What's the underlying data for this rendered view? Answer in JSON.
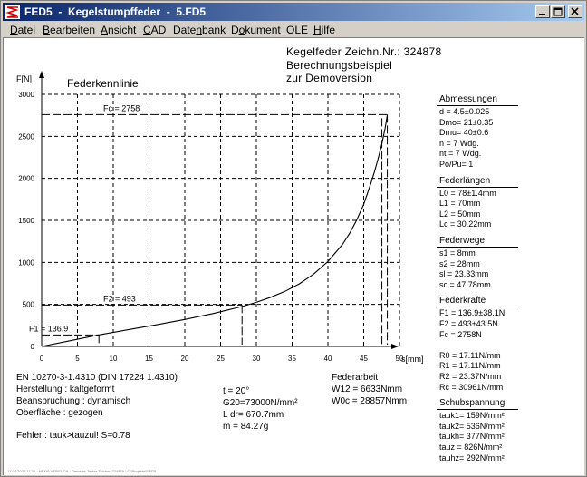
{
  "window": {
    "title": "FED5  -  Kegelstumpffeder  -  5.FD5",
    "icon": "fed5-app-icon",
    "buttons": [
      "minimize",
      "maximize",
      "close"
    ]
  },
  "menu": [
    {
      "label": "Datei",
      "u": 0
    },
    {
      "label": "Bearbeiten",
      "u": 0
    },
    {
      "label": "Ansicht",
      "u": 0
    },
    {
      "label": "CAD",
      "u": 0
    },
    {
      "label": "Datenbank",
      "u": 4
    },
    {
      "label": "Dokument",
      "u": 1
    },
    {
      "label": "OLE",
      "u": -1
    },
    {
      "label": "Hilfe",
      "u": 0
    }
  ],
  "header": {
    "line1": "Kegelfeder  Zeichn.Nr.: 324878",
    "line2": "Berechnungsbeispiel",
    "line3": "zur Demoversion"
  },
  "chart_data": {
    "type": "line",
    "title": "Federkennlinie",
    "ylabel": "F[N]",
    "xlabel": "s[mm]",
    "xlim": [
      0,
      50
    ],
    "ylim": [
      0,
      3000
    ],
    "xticks": [
      0,
      5,
      10,
      15,
      20,
      25,
      30,
      35,
      40,
      45,
      50
    ],
    "yticks": [
      0,
      500,
      1000,
      1500,
      2000,
      2500,
      3000
    ],
    "grid": true,
    "series": [
      {
        "x": [
          0,
          4,
          8,
          12,
          16,
          20,
          24,
          26,
          28,
          30,
          32,
          34,
          36,
          38,
          40,
          42,
          43,
          44,
          45,
          46,
          46.5,
          47,
          47.5,
          48,
          48.3
        ],
        "y": [
          0,
          68,
          136.9,
          197,
          257,
          320,
          392,
          434,
          475,
          525,
          585,
          655,
          745,
          860,
          1010,
          1210,
          1340,
          1500,
          1690,
          1940,
          2080,
          2230,
          2400,
          2600,
          2758
        ]
      }
    ],
    "annotations": [
      {
        "label": "Fc = 2758",
        "x": 48.3,
        "y": 2758
      },
      {
        "label": "F2 = 493",
        "x": 28,
        "y": 493
      },
      {
        "label": "F1 = 136.9",
        "x": 8,
        "y": 136.9
      }
    ]
  },
  "info_left": {
    "norm": "EN 10270-3-1.4310 (DIN 17224 1.4310)",
    "herstellung": "Herstellung : kaltgeformt",
    "beanspruchung": "Beanspruchung : dynamisch",
    "oberflaeche": "Oberfläche : gezogen",
    "fehler": "Fehler : tauk>tauzul! S=0.78"
  },
  "info_mid": {
    "t": "t  =  20°",
    "g20": "G20=73000N/mm²",
    "ldr": "L dr= 670.7mm",
    "m": "m = 84.27g"
  },
  "federarbeit": {
    "title": "Federarbeit",
    "w12": "W12 = 6633Nmm",
    "w0c": "W0c = 28857Nmm"
  },
  "right_panel": [
    {
      "title": "Abmessungen",
      "lines": [
        "d  = 4.5±0.025",
        "Dmo= 21±0.35",
        "Dmu= 40±0.6",
        "n  = 7 Wdg.",
        "nt = 7 Wdg.",
        "Po/Pu= 1"
      ]
    },
    {
      "title": "Federlängen",
      "lines": [
        "L0 = 78±1.4mm",
        "L1 = 70mm",
        "L2 = 50mm",
        "Lc = 30.22mm"
      ]
    },
    {
      "title": "Federwege",
      "lines": [
        "s1 = 8mm",
        "s2 = 28mm",
        "sl = 23.33mm",
        "sc = 47.78mm"
      ]
    },
    {
      "title": "Federkräfte",
      "lines": [
        "F1 = 136.9±38.1N",
        "F2 = 493±43.5N",
        "Fc = 2758N",
        "",
        "R0 = 17.11N/mm",
        "R1 = 17.11N/mm",
        "R2 = 23.37N/mm",
        "Rc = 30961N/mm"
      ]
    },
    {
      "title": "Schubspannung",
      "lines": [
        "tauk1=  159N/mm²",
        "tauk2=  536N/mm²",
        "taukh=  377N/mm²",
        "tauz =  826N/mm²",
        "tauhz=  292N/mm²"
      ]
    }
  ],
  "footer_note": "17.04.2023 17:26 · HEXIS VERSUCH · Getestet: Tester Zeichnr. 324878 · C:\\Projekte\\5.FD5"
}
